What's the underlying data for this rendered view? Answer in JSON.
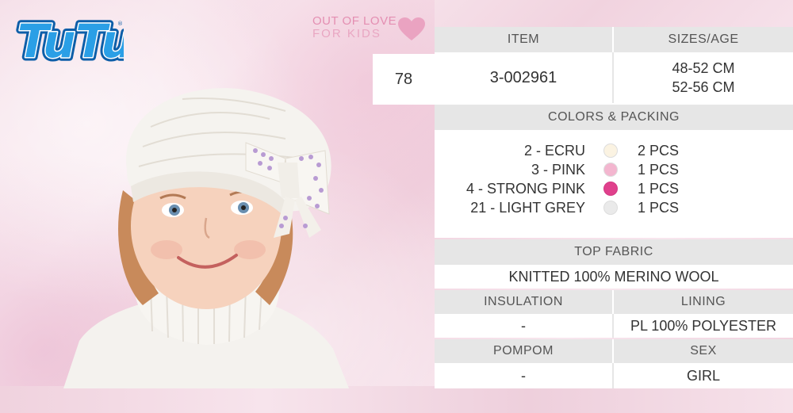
{
  "brand": {
    "logo_text": "TuTu",
    "tagline_line1": "OUT OF LOVE",
    "tagline_line2": "FOR KIDS"
  },
  "product": {
    "number": "78",
    "item_header": "ITEM",
    "item_value": "3-002961",
    "sizes_header": "SIZES/AGE",
    "sizes": [
      "48-52 CM",
      "52-56 CM"
    ]
  },
  "colors_packing": {
    "header": "COLORS & PACKING",
    "items": [
      {
        "name": "2 - ECRU",
        "color": "#fbf3e2",
        "pcs": "2 PCS"
      },
      {
        "name": "3 - PINK",
        "color": "#f3b6cf",
        "pcs": "1 PCS"
      },
      {
        "name": "4 - STRONG PINK",
        "color": "#e0408c",
        "pcs": "1 PCS"
      },
      {
        "name": "21 - LIGHT GREY",
        "color": "#eaeaea",
        "pcs": "1 PCS"
      }
    ]
  },
  "top_fabric": {
    "header": "TOP FABRIC",
    "value": "KNITTED 100% MERINO WOOL"
  },
  "insulation": {
    "header": "INSULATION",
    "value": "-"
  },
  "lining": {
    "header": "LINING",
    "value": "PL 100% POLYESTER"
  },
  "pompom": {
    "header": "POMPOM",
    "value": "-"
  },
  "sex": {
    "header": "SEX",
    "value": "GIRL"
  },
  "colors": {
    "logo_blue": "#1f8fd6",
    "accent_pink": "#e48fb2",
    "header_grey": "#e6e6e6"
  }
}
